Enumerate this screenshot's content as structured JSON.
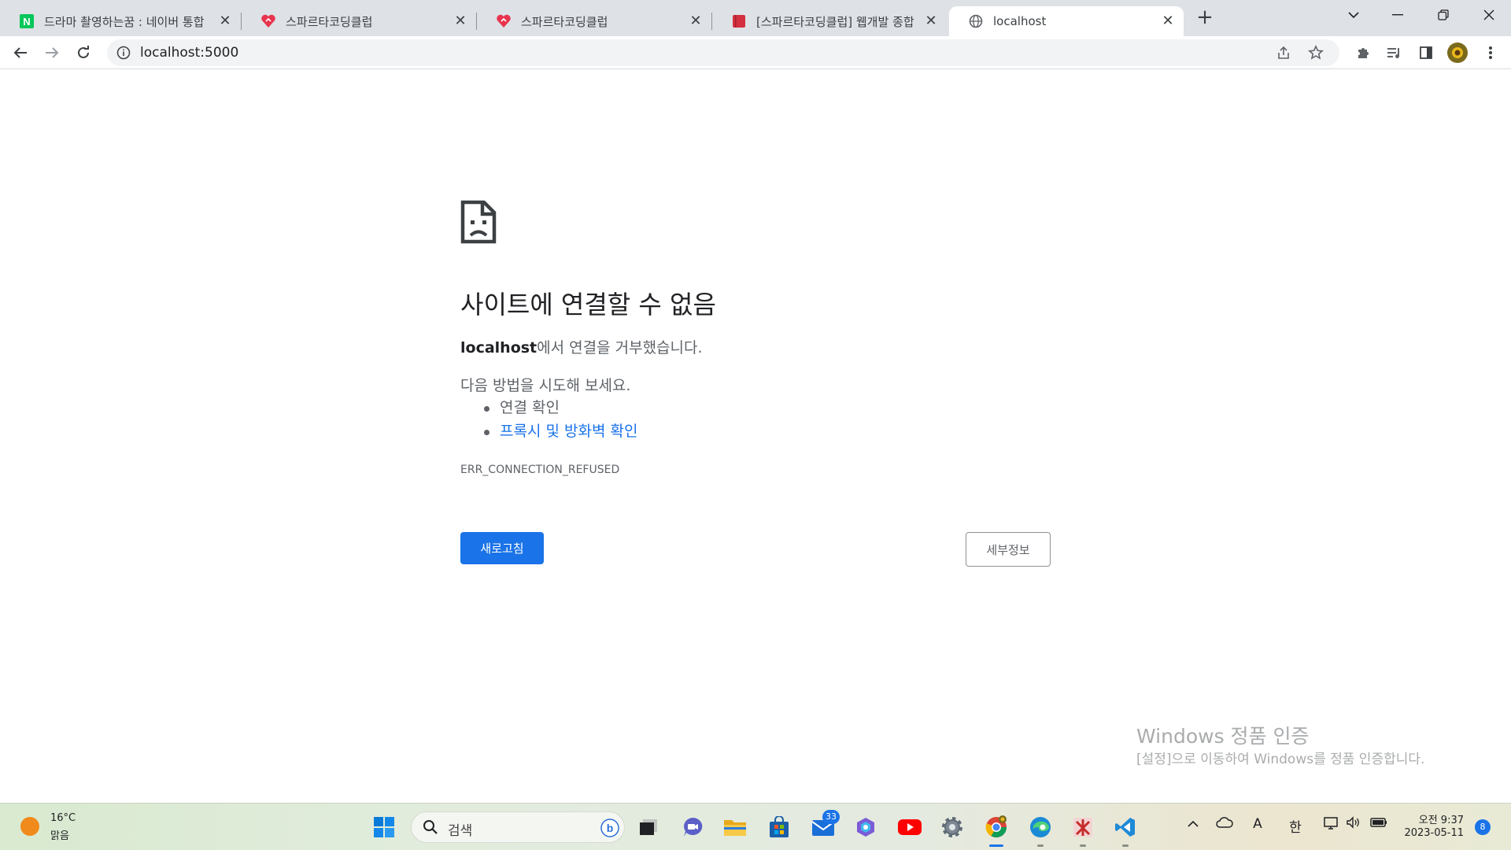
{
  "browser": {
    "tabs": [
      {
        "title": "드라마 촬영하는꿈 : 네이버 통합",
        "icon": "naver-icon",
        "active": false
      },
      {
        "title": "스파르타코딩클럽",
        "icon": "sparta-icon",
        "active": false
      },
      {
        "title": "스파르타코딩클럽",
        "icon": "sparta-icon",
        "active": false
      },
      {
        "title": "[스파르타코딩클럽] 웹개발 종합",
        "icon": "book-icon",
        "active": false
      },
      {
        "title": "localhost",
        "icon": "globe-icon",
        "active": true
      }
    ],
    "url": "localhost:5000"
  },
  "error_page": {
    "title": "사이트에 연결할 수 없음",
    "host": "localhost",
    "message_suffix": "에서 연결을 거부했습니다.",
    "suggest_heading": "다음 방법을 시도해 보세요.",
    "suggestions": [
      {
        "text": "연결 확인",
        "is_link": false
      },
      {
        "text": "프록시 및 방화벽 확인",
        "is_link": true
      }
    ],
    "error_code": "ERR_CONNECTION_REFUSED",
    "reload_label": "새로고침",
    "details_label": "세부정보"
  },
  "watermark": {
    "title": "Windows 정품 인증",
    "subtitle": "[설정]으로 이동하여 Windows를 정품 인증합니다."
  },
  "taskbar": {
    "weather_temp": "16°C",
    "weather_condition": "맑음",
    "search_placeholder": "검색",
    "mail_badge": "33",
    "tray_ime_a": "A",
    "tray_ime_han": "한",
    "time": "오전 9:37",
    "date": "2023-05-11",
    "notification_count": "8"
  },
  "colors": {
    "accent": "#1a73e8",
    "tabstrip": "#dee1e6",
    "link": "#1a73e8"
  }
}
